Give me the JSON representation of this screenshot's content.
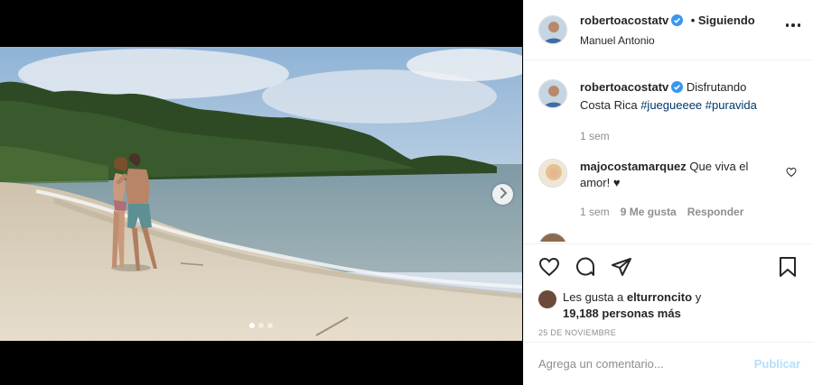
{
  "post": {
    "username": "robertoacostatv",
    "follow_status": "• Siguiendo",
    "location": "Manuel Antonio"
  },
  "caption": {
    "username": "robertoacostatv",
    "text": "Disfrutando Costa Rica",
    "hashtags": [
      "#juegueeee",
      "#puravida"
    ],
    "time": "1 sem"
  },
  "comments": [
    {
      "username": "majocostamarquez",
      "text": "Que viva el amor! ♥",
      "time": "1 sem",
      "likes": "9 Me gusta",
      "reply": "Responder"
    }
  ],
  "likes": {
    "prefix": "Les gusta a",
    "user": "elturroncito",
    "joiner": "y",
    "count_text": "19,188 personas más"
  },
  "date": "25 DE NOVIEMBRE",
  "add_comment": {
    "placeholder": "Agrega un comentario...",
    "publish": "Publicar"
  },
  "carousel": {
    "slides": 3,
    "active": 1
  },
  "icons": {
    "verified": "verified-badge-icon",
    "more": "more-options-icon",
    "like": "heart-icon",
    "comment": "comment-icon",
    "share": "share-icon",
    "save": "bookmark-icon",
    "next": "chevron-right-icon"
  },
  "colors": {
    "verified": "#3897f0",
    "link": "#00376b",
    "publish_disabled": "#b2dffc",
    "muted": "#8e8e8e"
  }
}
